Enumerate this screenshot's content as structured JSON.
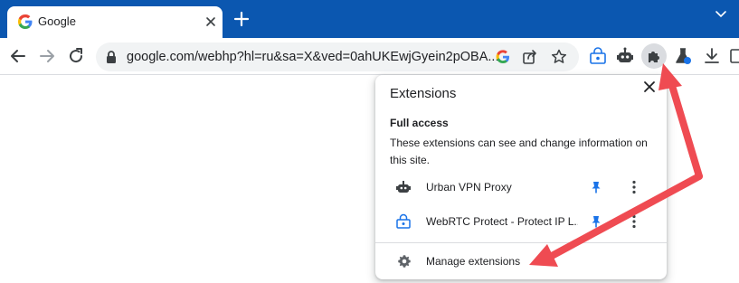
{
  "colors": {
    "titlebar": "#0b57b0",
    "accent": "#1a73e8",
    "arrow": "#ef4b52"
  },
  "tab": {
    "title": "Google",
    "favicon": "google-g-icon"
  },
  "toolbar": {
    "url": "google.com/webhp?hl=ru&sa=X&ved=0ahUKEwjGyein2pOBA..."
  },
  "popup": {
    "title": "Extensions",
    "section_title": "Full access",
    "section_desc": "These extensions can see and change information on this site.",
    "extensions": [
      {
        "name": "Urban VPN Proxy",
        "icon": "robot-icon",
        "pinned": true
      },
      {
        "name": "WebRTC Protect - Protect IP L...",
        "icon": "lock-shield-icon",
        "pinned": true
      }
    ],
    "manage_label": "Manage extensions"
  }
}
